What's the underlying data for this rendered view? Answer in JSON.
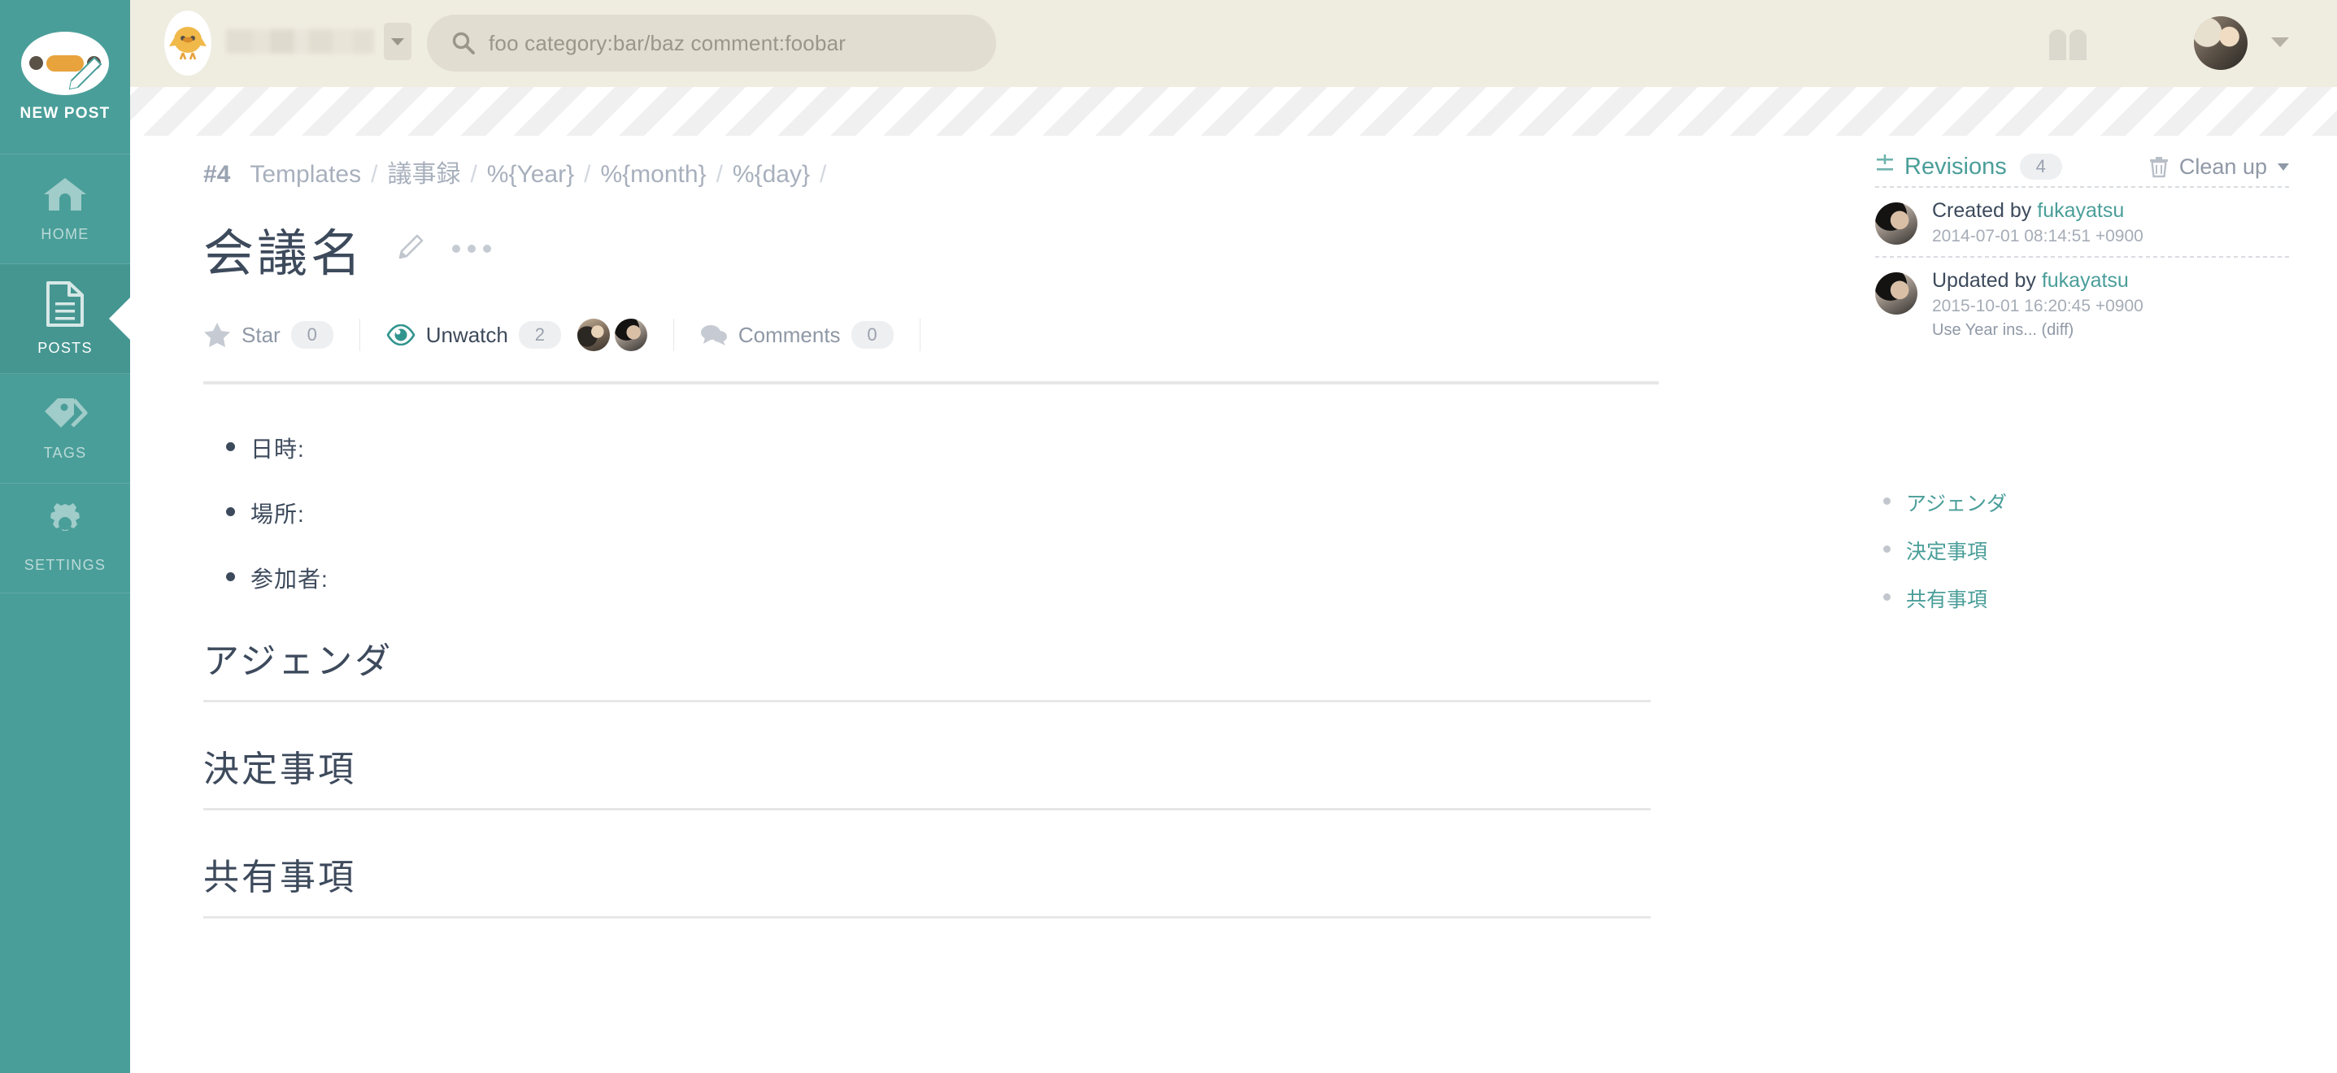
{
  "sidebar": {
    "new_post": {
      "label": "NEW POST",
      "icon": "chick-pencil-icon"
    },
    "items": [
      {
        "label": "HOME",
        "icon": "home-icon",
        "active": false
      },
      {
        "label": "POSTS",
        "icon": "document-icon",
        "active": true
      },
      {
        "label": "TAGS",
        "icon": "tags-icon",
        "active": false
      },
      {
        "label": "SETTINGS",
        "icon": "gear-icon",
        "active": false
      }
    ]
  },
  "header": {
    "brand_icon": "chick-logo-icon",
    "team_name": "",
    "team_caret_icon": "caret-down-icon",
    "search": {
      "icon": "search-icon",
      "value": "",
      "placeholder": "foo category:bar/baz comment:foobar"
    },
    "notebook_icon": "notebook-icon",
    "avatar_icon": "user-avatar",
    "user_caret_icon": "caret-down-icon"
  },
  "post": {
    "breadcrumb": {
      "id": "#4",
      "crumbs": [
        "Templates",
        "議事録",
        "%{Year}",
        "%{month}",
        "%{day}"
      ],
      "separator": "/",
      "trailing_separator": "/"
    },
    "title": "会議名",
    "edit_icon": "pencil-icon",
    "more_icon": "ellipsis-icon",
    "actions": {
      "star": {
        "icon": "star-icon",
        "label": "Star",
        "count": "0"
      },
      "watch": {
        "icon": "eye-icon",
        "label": "Unwatch",
        "count": "2"
      },
      "comments": {
        "icon": "comment-icon",
        "label": "Comments",
        "count": "0"
      }
    },
    "body": {
      "bullets": [
        "日時:",
        "場所:",
        "参加者:"
      ],
      "sections": [
        "アジェンダ",
        "決定事項",
        "共有事項"
      ]
    }
  },
  "revisions": {
    "icon": "diff-icon",
    "title": "Revisions",
    "count": "4",
    "cleanup": {
      "icon": "trash-icon",
      "label": "Clean up",
      "caret": "caret-down-icon"
    },
    "items": [
      {
        "action": "Created by ",
        "user": "fukayatsu",
        "timestamp": "2014-07-01 08:14:51 +0900",
        "note": ""
      },
      {
        "action": "Updated by ",
        "user": "fukayatsu",
        "timestamp": "2015-10-01 16:20:45 +0900",
        "note": "Use Year ins... (diff)"
      }
    ]
  },
  "toc": {
    "items": [
      "アジェンダ",
      "決定事項",
      "共有事項"
    ]
  },
  "colors": {
    "brand_teal": "#4a9e99",
    "sidebar_active": "#459691",
    "header_cream": "#efece0",
    "text_dark": "#3d4a5c",
    "text_muted": "#8f98a6",
    "rule": "#e7e7e7"
  }
}
